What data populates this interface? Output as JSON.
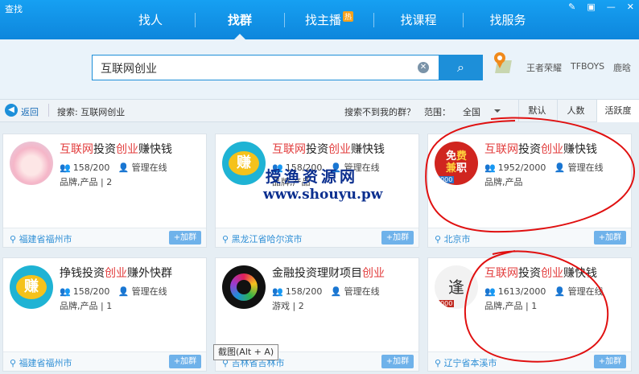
{
  "window": {
    "title": "查找"
  },
  "tabs": [
    {
      "label": "找人"
    },
    {
      "label": "找群"
    },
    {
      "label": "找主播",
      "badge": "热"
    },
    {
      "label": "找课程"
    },
    {
      "label": "找服务"
    }
  ],
  "search": {
    "value": "互联网创业"
  },
  "hot_keywords": [
    "王者荣耀",
    "TFBOYS",
    "鹿晗"
  ],
  "filter": {
    "back_label": "返回",
    "search_summary": "搜索: 互联网创业",
    "not_found": "搜索不到我的群？",
    "range_label": "范围：",
    "range_value": "全国",
    "sort_options": [
      "默认",
      "人数",
      "活跃度"
    ],
    "active_sort": "活跃度"
  },
  "cards": [
    {
      "name_prefix": "",
      "name_kw1": "互联网",
      "name_mid": "投资",
      "name_kw2": "创业",
      "name_suffix": "赚快钱",
      "members": "158/200",
      "admin": "管理在线",
      "tags": "品牌,产品 | 2",
      "location": "福建省福州市",
      "join": "+加群",
      "avatar": "anime-girl"
    },
    {
      "name_prefix": "",
      "name_kw1": "互联网",
      "name_mid": "投资",
      "name_kw2": "创业",
      "name_suffix": "赚快钱",
      "members": "158/200",
      "admin": "管理在线",
      "tags": "品牌,产品",
      "location": "黑龙江省哈尔滨市",
      "join": "+加群",
      "avatar": "zhuan"
    },
    {
      "name_prefix": "",
      "name_kw1": "互联网",
      "name_mid": "投资",
      "name_kw2": "创业",
      "name_suffix": "赚快钱",
      "members": "1952/2000",
      "admin": "管理在线",
      "tags": "品牌,产品",
      "location": "北京市",
      "join": "+加群",
      "avatar": "mianfei"
    },
    {
      "name_prefix": "挣钱投资",
      "name_kw1": "",
      "name_mid": "",
      "name_kw2": "创业",
      "name_suffix": "赚外快群",
      "members": "158/200",
      "admin": "管理在线",
      "tags": "品牌,产品 | 1",
      "location": "福建省福州市",
      "join": "+加群",
      "avatar": "zhuan"
    },
    {
      "name_prefix": "金融投资理财项目",
      "name_kw1": "",
      "name_mid": "",
      "name_kw2": "创业",
      "name_suffix": "",
      "members": "158/200",
      "admin": "管理在线",
      "tags": "游戏 | 2",
      "location": "吉林省吉林市",
      "join": "+加群",
      "avatar": "colorful"
    },
    {
      "name_prefix": "",
      "name_kw1": "互联网",
      "name_mid": "投资",
      "name_kw2": "创业",
      "name_suffix": "赚快钱",
      "members": "1613/2000",
      "admin": "管理在线",
      "tags": "品牌,产品 | 1",
      "location": "辽宁省本溪市",
      "join": "+加群",
      "avatar": "calligraphy"
    }
  ],
  "watermark": {
    "line1": "授渔资源网",
    "line2": "www.shouyu.pw"
  },
  "tooltip": "截图(Alt + A)",
  "avatar_labels": {
    "zhuan": "赚",
    "mianfei_1": "免",
    "mianfei_2": "费",
    "mianfei_3": "兼",
    "mianfei_4": "职",
    "mianfei_level": "2000",
    "calligraphy_level": "2000"
  },
  "colors": {
    "titlebar": "#0e86dc",
    "keyword": "#e23c3c",
    "annotation": "#e01010"
  }
}
